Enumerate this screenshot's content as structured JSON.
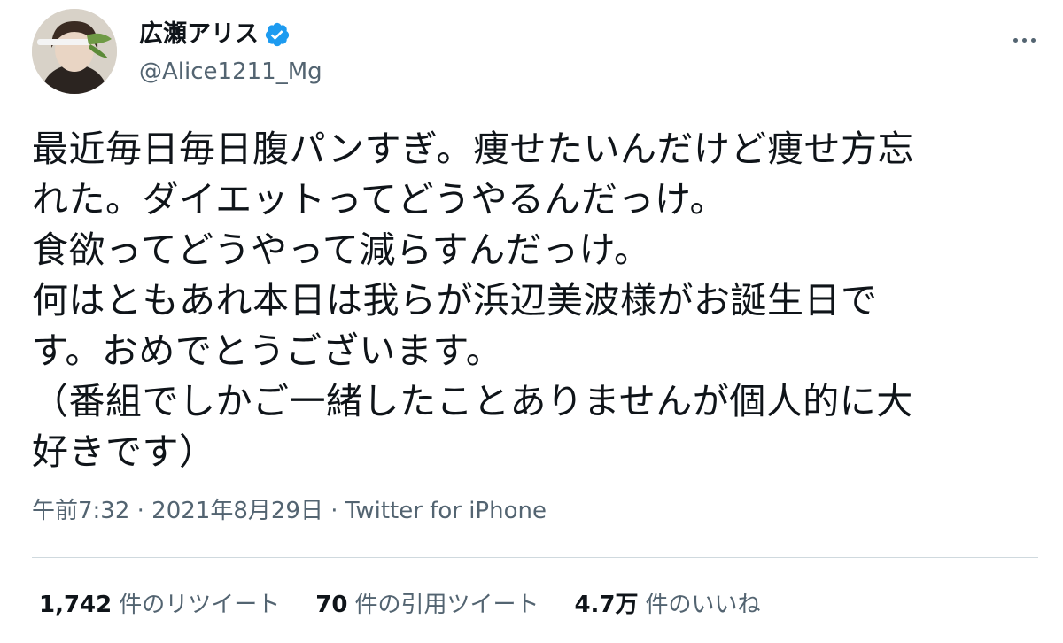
{
  "author": {
    "display_name": "広瀬アリス",
    "handle": "@Alice1211_Mg",
    "verified": true
  },
  "tweet": {
    "text": "最近毎日毎日腹パンすぎ。痩せたいんだけど痩せ方忘\nれた。ダイエットってどうやるんだっけ。\n食欲ってどうやって減らすんだっけ。\n何はともあれ本日は我らが浜辺美波様がお誕生日で\nす。おめでとうございます。\n（番組でしかご一緒したことありませんが個人的に大\n好きです）",
    "meta": "午前7:32 · 2021年8月29日 · Twitter for iPhone"
  },
  "stats": {
    "retweets": {
      "count": "1,742",
      "label": "件のリツイート"
    },
    "quotes": {
      "count": "70",
      "label": "件の引用ツイート"
    },
    "likes": {
      "count": "4.7万",
      "label": "件のいいね"
    }
  },
  "colors": {
    "text": "#0f1419",
    "secondary": "#536471",
    "verified_blue": "#1d9bf0",
    "divider": "#cfd9de"
  }
}
